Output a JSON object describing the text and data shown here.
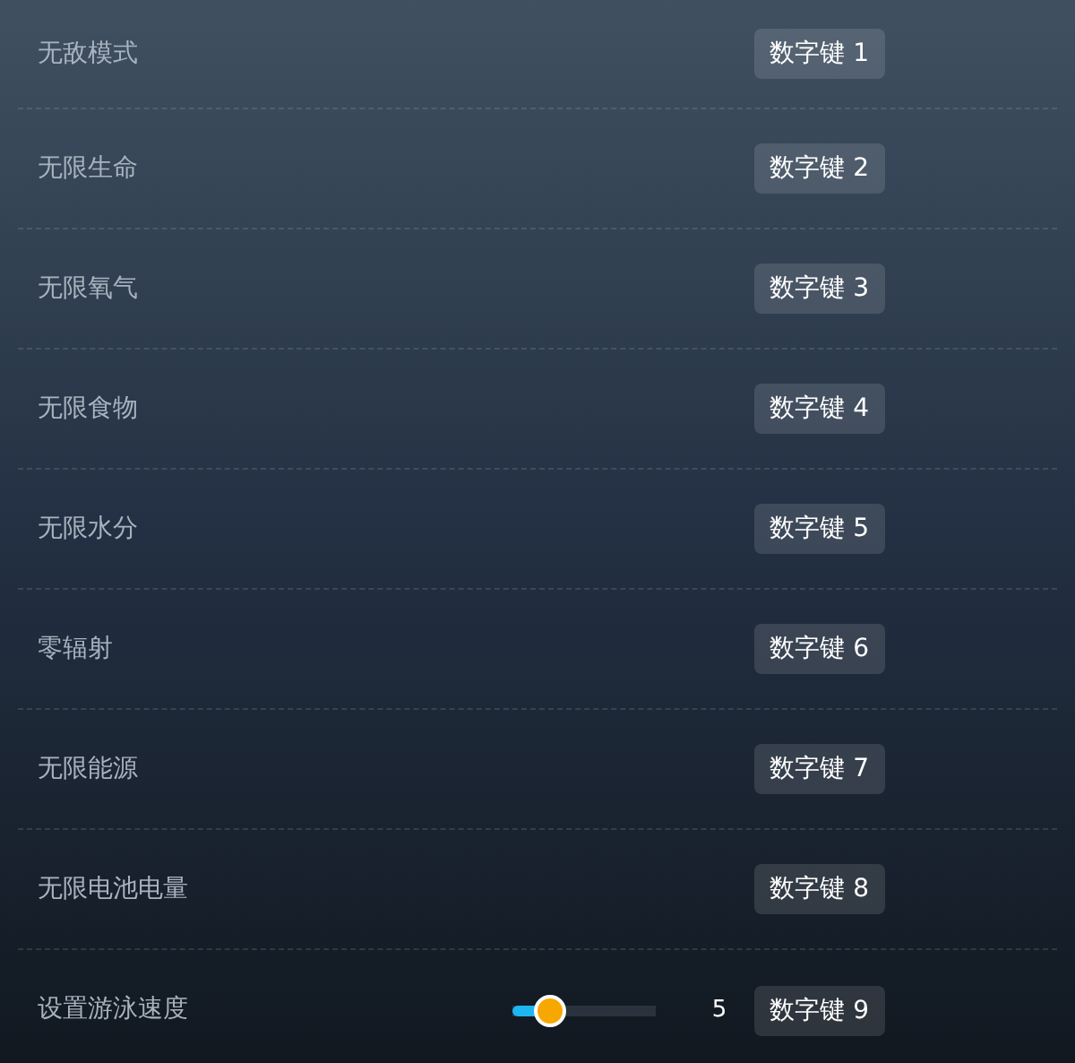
{
  "options": [
    {
      "kind": "toggle",
      "label": "无敌模式",
      "hotkey": "数字键 1"
    },
    {
      "kind": "toggle",
      "label": "无限生命",
      "hotkey": "数字键 2"
    },
    {
      "kind": "toggle",
      "label": "无限氧气",
      "hotkey": "数字键 3"
    },
    {
      "kind": "toggle",
      "label": "无限食物",
      "hotkey": "数字键 4"
    },
    {
      "kind": "toggle",
      "label": "无限水分",
      "hotkey": "数字键 5"
    },
    {
      "kind": "toggle",
      "label": "零辐射",
      "hotkey": "数字键 6"
    },
    {
      "kind": "toggle",
      "label": "无限能源",
      "hotkey": "数字键 7"
    },
    {
      "kind": "toggle",
      "label": "无限电池电量",
      "hotkey": "数字键 8"
    },
    {
      "kind": "slider",
      "label": "设置游泳速度",
      "level": 0.27,
      "reading": "5",
      "hotkey": "数字键 9"
    }
  ]
}
